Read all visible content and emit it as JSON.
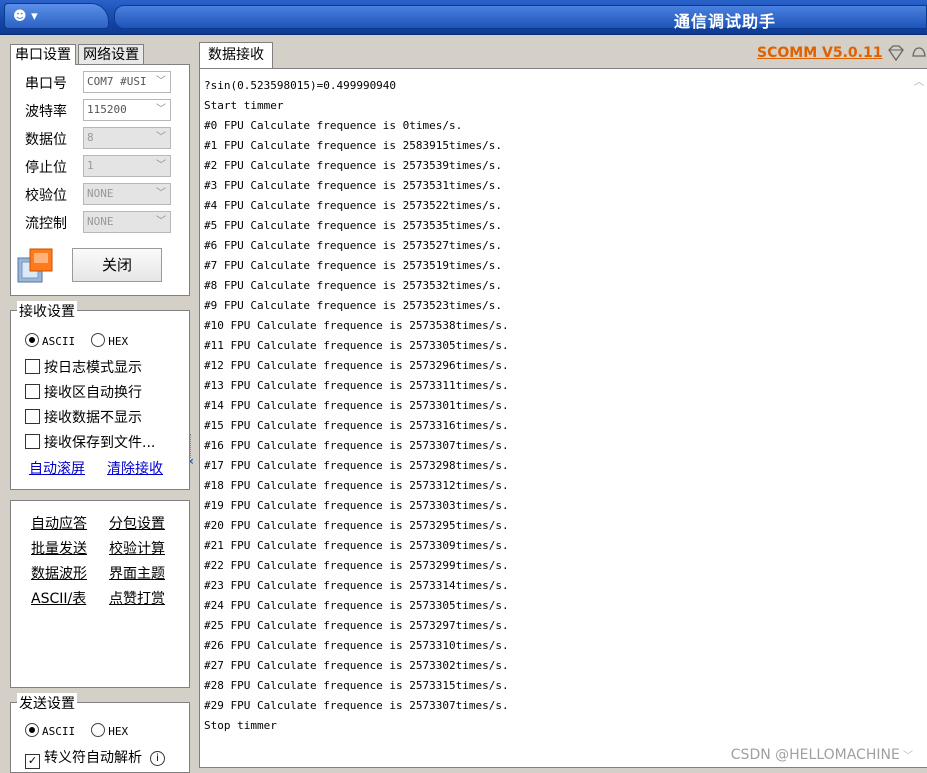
{
  "window": {
    "title": "通信调试助手",
    "menu_label": "☻ ▾"
  },
  "left_tabs": [
    {
      "label": "串口设置"
    },
    {
      "label": "网络设置"
    }
  ],
  "serial": {
    "port_label": "串口号",
    "port_value": "COM7 #USI",
    "baud_label": "波特率",
    "baud_value": "115200",
    "data_label": "数据位",
    "data_value": "8",
    "stop_label": "停止位",
    "stop_value": "1",
    "parity_label": "校验位",
    "parity_value": "NONE",
    "flow_label": "流控制",
    "flow_value": "NONE",
    "close_button": "关闭"
  },
  "receive_settings": {
    "title": "接收设置",
    "ascii_label": "ASCII",
    "hex_label": "HEX",
    "selected": "ASCII",
    "options": [
      {
        "label": "按日志模式显示",
        "checked": false
      },
      {
        "label": "接收区自动换行",
        "checked": false
      },
      {
        "label": "接收数据不显示",
        "checked": false
      },
      {
        "label": "接收保存到文件...",
        "checked": false
      }
    ],
    "auto_scroll_link": "自动滚屏",
    "clear_link": "清除接收"
  },
  "tools": [
    [
      "自动应答",
      "分包设置"
    ],
    [
      "批量发送",
      "校验计算"
    ],
    [
      "数据波形",
      "界面主题"
    ],
    [
      "ASCII/表",
      "点赞打赏"
    ]
  ],
  "send_settings": {
    "title": "发送设置",
    "ascii_label": "ASCII",
    "hex_label": "HEX",
    "selected": "ASCII",
    "escape_label": "转义符自动解析",
    "escape_checked": true,
    "info_icon": "i"
  },
  "receive_tab": {
    "label": "数据接收"
  },
  "version": "SCOMM V5.0.11",
  "received_lines": [
    "?sin(0.523598015)=0.499990940",
    "Start timmer",
    "#0 FPU Calculate frequence is 0times/s.",
    "#1 FPU Calculate frequence is 2583915times/s.",
    "#2 FPU Calculate frequence is 2573539times/s.",
    "#3 FPU Calculate frequence is 2573531times/s.",
    "#4 FPU Calculate frequence is 2573522times/s.",
    "#5 FPU Calculate frequence is 2573535times/s.",
    "#6 FPU Calculate frequence is 2573527times/s.",
    "#7 FPU Calculate frequence is 2573519times/s.",
    "#8 FPU Calculate frequence is 2573532times/s.",
    "#9 FPU Calculate frequence is 2573523times/s.",
    "#10 FPU Calculate frequence is 2573538times/s.",
    "#11 FPU Calculate frequence is 2573305times/s.",
    "#12 FPU Calculate frequence is 2573296times/s.",
    "#13 FPU Calculate frequence is 2573311times/s.",
    "#14 FPU Calculate frequence is 2573301times/s.",
    "#15 FPU Calculate frequence is 2573316times/s.",
    "#16 FPU Calculate frequence is 2573307times/s.",
    "#17 FPU Calculate frequence is 2573298times/s.",
    "#18 FPU Calculate frequence is 2573312times/s.",
    "#19 FPU Calculate frequence is 2573303times/s.",
    "#20 FPU Calculate frequence is 2573295times/s.",
    "#21 FPU Calculate frequence is 2573309times/s.",
    "#22 FPU Calculate frequence is 2573299times/s.",
    "#23 FPU Calculate frequence is 2573314times/s.",
    "#24 FPU Calculate frequence is 2573305times/s.",
    "#25 FPU Calculate frequence is 2573297times/s.",
    "#26 FPU Calculate frequence is 2573310times/s.",
    "#27 FPU Calculate frequence is 2573302times/s.",
    "#28 FPU Calculate frequence is 2573315times/s.",
    "#29 FPU Calculate frequence is 2573307times/s.",
    "Stop timmer"
  ],
  "watermark": "CSDN @HELLOMACHINE",
  "colors": {
    "title_bar": "#1547a8",
    "version_text": "#e06000",
    "link": "#0000cc"
  },
  "icons": {
    "menu": "smiley-icon",
    "port": "serial-port-icon",
    "version_a": "diamond-icon",
    "version_b": "bell-icon"
  }
}
